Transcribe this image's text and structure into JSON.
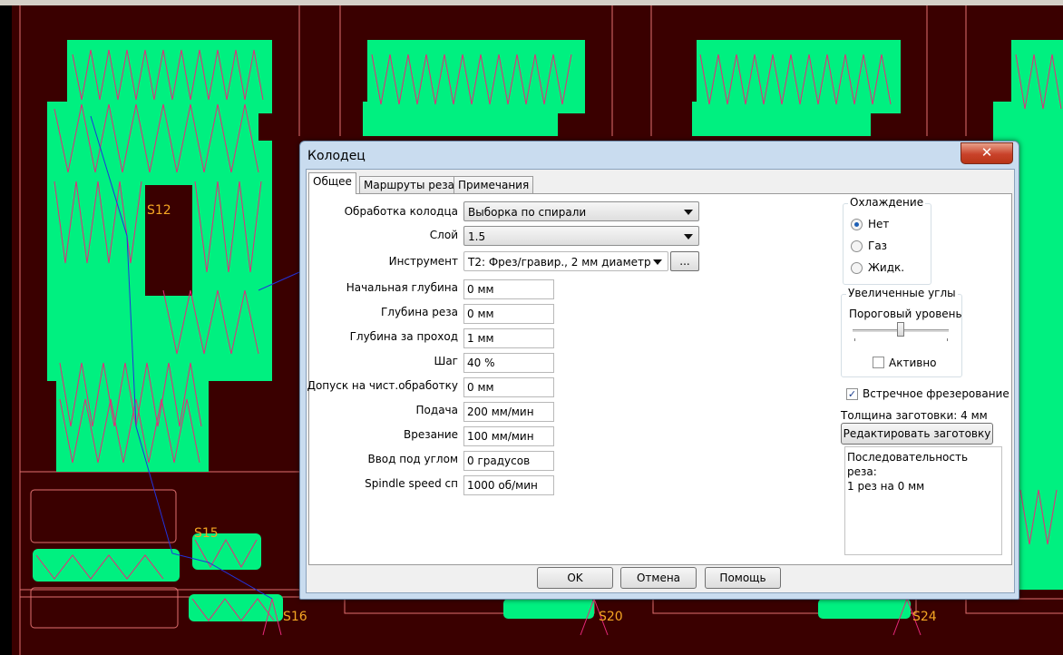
{
  "canvas": {
    "labels": [
      "S12",
      "S15",
      "S16",
      "S20",
      "S24"
    ]
  },
  "dialog": {
    "title": "Колодец",
    "close_glyph": "✕",
    "tabs": [
      "Общее",
      "Маршруты реза",
      "Примечания"
    ],
    "active_tab": "Общее",
    "fields": {
      "pocket_mode": {
        "label": "Обработка колодца",
        "value": "Выборка по спирали"
      },
      "layer": {
        "label": "Слой",
        "value": "1.5"
      },
      "tool": {
        "label": "Инструмент",
        "value": "T2: Фрез/гравир., 2 мм диаметр",
        "browse_label": "..."
      },
      "start_depth": {
        "label": "Начальная глубина",
        "value": "0 мм"
      },
      "cut_depth": {
        "label": "Глубина реза",
        "value": "0 мм"
      },
      "step_depth": {
        "label": "Глубина за проход",
        "value": "1 мм"
      },
      "stepover": {
        "label": "Шаг",
        "value": "40 %"
      },
      "finish_allowance": {
        "label": "Допуск на чист.обработку",
        "value": "0 мм"
      },
      "feed": {
        "label": "Подача",
        "value": "200 мм/мин"
      },
      "plunge": {
        "label": "Врезание",
        "value": "100 мм/мин"
      },
      "ramp": {
        "label": "Ввод под углом",
        "value": "0 градусов"
      },
      "spindle": {
        "label": "Spindle speed сп",
        "value": "1000 об/мин"
      }
    },
    "cooling": {
      "title": "Охлаждение",
      "options": [
        "Нет",
        "Газ",
        "Жидк."
      ],
      "selected": "Нет"
    },
    "corners": {
      "title": "Увеличенные углы",
      "threshold_label": "Пороговый уровень",
      "threshold_level": 0.5,
      "active_label": "Активно",
      "active_checked": false
    },
    "climb": {
      "label": "Встречное фрезерование",
      "checked": true,
      "check_glyph": "✓"
    },
    "thickness_text": "Толщина заготовки: 4 мм",
    "edit_stock_label": "Редактировать заготовку",
    "sequence": {
      "line1": "Последовательность реза:",
      "line2": "1 рез на 0 мм"
    },
    "buttons": {
      "ok": "OK",
      "cancel": "Отмена",
      "help": "Помощь"
    }
  },
  "colors": {
    "board": "#3a0000",
    "copper": "#00f080",
    "toolpath_zigzag": "#e8287a",
    "toolpath_link": "#2233dd",
    "outline": "#e07070",
    "label": "#f5a623"
  }
}
